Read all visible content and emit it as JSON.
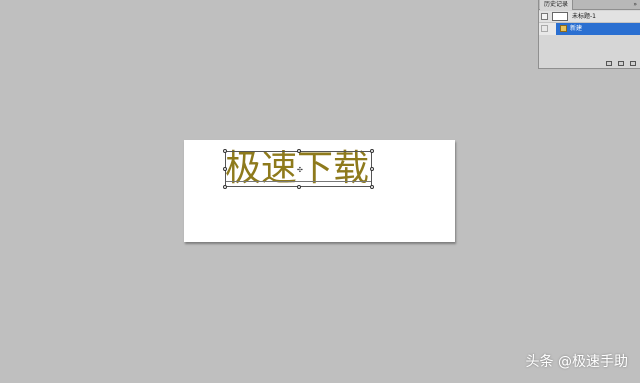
{
  "history_panel": {
    "tab_label": "历史记录",
    "menu_glyph": "»",
    "snapshot": {
      "label": "未标题-1",
      "brush_icon": "brush-source-icon"
    },
    "steps": [
      {
        "label": "新建",
        "selected": true,
        "icon": "new-document-step-icon"
      }
    ],
    "footer_icons": [
      "new-document-from-state-icon",
      "create-snapshot-icon",
      "delete-icon"
    ]
  },
  "canvas": {
    "text": "极速下载",
    "text_color": "#8e7a1c",
    "background": "#ffffff"
  },
  "workspace": {
    "background": "#bfbfbf",
    "accent": "#2a6fd1"
  },
  "watermark": {
    "text": "头条 @极速手助"
  }
}
